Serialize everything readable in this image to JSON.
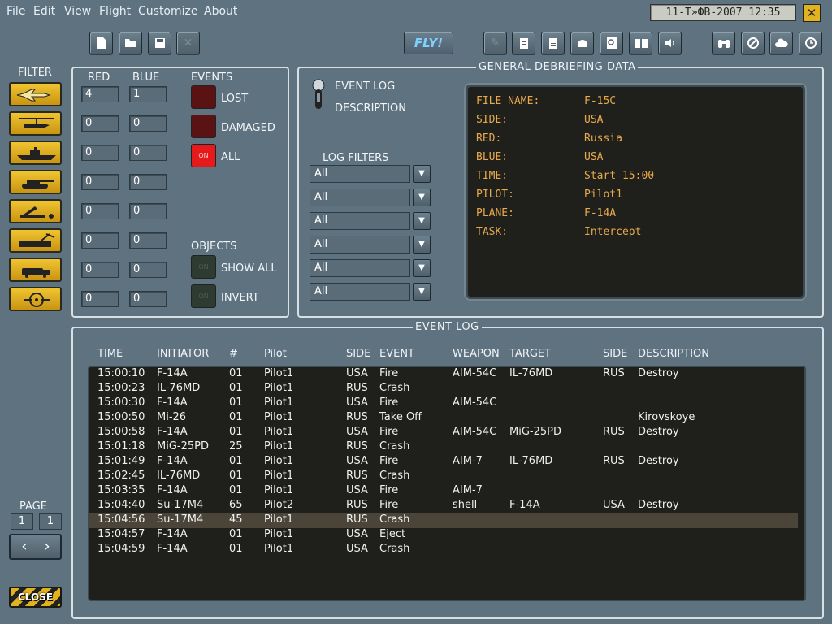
{
  "menu": [
    "File",
    "Edit",
    "View",
    "Flight",
    "Customize",
    "About"
  ],
  "datetime": "11-Т»ФВ-2007  12:35",
  "toolbar": {
    "fly_label": "FLY!"
  },
  "filter": {
    "title": "FILTER",
    "red_header": "RED",
    "blue_header": "BLUE",
    "units": [
      {
        "icon": "fighter-jet-icon",
        "red": "4",
        "blue": "1"
      },
      {
        "icon": "helicopter-icon",
        "red": "0",
        "blue": "0"
      },
      {
        "icon": "ship-icon",
        "red": "0",
        "blue": "0"
      },
      {
        "icon": "tank-icon",
        "red": "0",
        "blue": "0"
      },
      {
        "icon": "sam-launcher-icon",
        "red": "0",
        "blue": "0"
      },
      {
        "icon": "radar-vehicle-icon",
        "red": "0",
        "blue": "0"
      },
      {
        "icon": "truck-icon",
        "red": "0",
        "blue": "0"
      },
      {
        "icon": "target-icon",
        "red": "0",
        "blue": "0"
      }
    ],
    "events_title": "EVENTS",
    "events": [
      {
        "label": "LOST",
        "state": "off"
      },
      {
        "label": "DAMAGED",
        "state": "off"
      },
      {
        "label": "ALL",
        "state": "on"
      }
    ],
    "objects_title": "OBJECTS",
    "objects": [
      {
        "label": "SHOW ALL",
        "state": "off"
      },
      {
        "label": "INVERT",
        "state": "off"
      }
    ],
    "led_on_text": "ON"
  },
  "general": {
    "title": "GENERAL DEBRIEFING DATA",
    "toggle_top": "EVENT LOG",
    "toggle_bottom": "DESCRIPTION",
    "log_filters_title": "LOG FILTERS",
    "log_filters": [
      "All",
      "All",
      "All",
      "All",
      "All",
      "All"
    ],
    "fields": [
      {
        "key": "FILE NAME:",
        "value": "F-15C"
      },
      {
        "key": "SIDE:",
        "value": "USA"
      },
      {
        "key": "RED:",
        "value": "Russia"
      },
      {
        "key": "BLUE:",
        "value": "USA"
      },
      {
        "key": "TIME:",
        "value": "Start 15:00"
      },
      {
        "key": "PILOT:",
        "value": "Pilot1"
      },
      {
        "key": "PLANE:",
        "value": "F-14A"
      },
      {
        "key": "TASK:",
        "value": "Intercept"
      }
    ]
  },
  "event_log": {
    "title": "EVENT LOG",
    "columns": [
      "TIME",
      "INITIATOR",
      "#",
      "Pilot",
      "SIDE",
      "EVENT",
      "WEAPON",
      "TARGET",
      "SIDE",
      "DESCRIPTION"
    ],
    "rows": [
      [
        "15:00:10",
        "F-14A",
        "01",
        "Pilot1",
        "USA",
        "Fire",
        "AIM-54C",
        "IL-76MD",
        "RUS",
        "Destroy"
      ],
      [
        "15:00:23",
        "IL-76MD",
        "01",
        "Pilot1",
        "RUS",
        "Crash",
        "",
        "",
        "",
        ""
      ],
      [
        "15:00:30",
        "F-14A",
        "01",
        "Pilot1",
        "USA",
        "Fire",
        "AIM-54C",
        "",
        "",
        ""
      ],
      [
        "15:00:50",
        "Mi-26",
        "01",
        "Pilot1",
        "RUS",
        "Take Off",
        "",
        "",
        "",
        "Kirovskoye"
      ],
      [
        "15:00:58",
        "F-14A",
        "01",
        "Pilot1",
        "USA",
        "Fire",
        "AIM-54C",
        "MiG-25PD",
        "RUS",
        "Destroy"
      ],
      [
        "15:01:18",
        "MiG-25PD",
        "25",
        "Pilot1",
        "RUS",
        "Crash",
        "",
        "",
        "",
        ""
      ],
      [
        "15:01:49",
        "F-14A",
        "01",
        "Pilot1",
        "USA",
        "Fire",
        "AIM-7",
        "IL-76MD",
        "RUS",
        "Destroy"
      ],
      [
        "15:02:45",
        "IL-76MD",
        "01",
        "Pilot1",
        "RUS",
        "Crash",
        "",
        "",
        "",
        ""
      ],
      [
        "15:03:35",
        "F-14A",
        "01",
        "Pilot1",
        "USA",
        "Fire",
        "AIM-7",
        "",
        "",
        ""
      ],
      [
        "15:04:40",
        "Su-17M4",
        "65",
        "Pilot2",
        "RUS",
        "Fire",
        "shell",
        "F-14A",
        "USA",
        "Destroy"
      ],
      [
        "15:04:56",
        "Su-17M4",
        "45",
        "Pilot1",
        "RUS",
        "Crash",
        "",
        "",
        "",
        ""
      ],
      [
        "15:04:57",
        "F-14A",
        "01",
        "Pilot1",
        "USA",
        "Eject",
        "",
        "",
        "",
        ""
      ],
      [
        "15:04:59",
        "F-14A",
        "01",
        "Pilot1",
        "USA",
        "Crash",
        "",
        "",
        "",
        ""
      ]
    ],
    "selected_row": 10
  },
  "page": {
    "label": "PAGE",
    "current": "1",
    "total": "1"
  },
  "close_label": "CLOSE"
}
